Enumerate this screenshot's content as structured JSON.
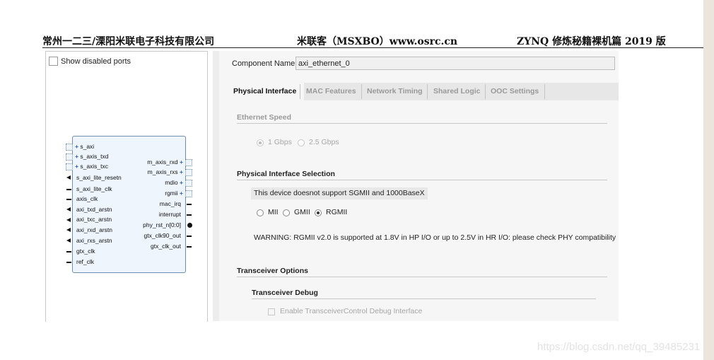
{
  "header": {
    "left": "常州一二三/溧阳米联电子科技有限公司",
    "center": "米联客（MSXBO）www.osrc.cn",
    "right": "ZYNQ 修炼秘籍裸机篇 2019 版"
  },
  "left_panel": {
    "show_disabled_label": "Show disabled ports",
    "show_disabled_checked": false,
    "left_ports": [
      "s_axi",
      "s_axis_txd",
      "s_axis_txc",
      "s_axi_lite_resetn",
      "s_axi_lite_clk",
      "axis_clk",
      "axi_txd_arstn",
      "axi_txc_arstn",
      "axi_rxd_arstn",
      "axi_rxs_arstn",
      "gtx_clk",
      "ref_clk"
    ],
    "right_ports": [
      "m_axis_rxd",
      "m_axis_rxs",
      "mdio",
      "rgmii",
      "mac_irq",
      "interrupt",
      "phy_rst_n[0:0]",
      "gtx_clk90_out",
      "gtx_clk_out"
    ]
  },
  "component": {
    "label": "Component Name",
    "value": "axi_ethernet_0"
  },
  "tabs": [
    "Physical Interface",
    "MAC Features",
    "Network Timing",
    "Shared Logic",
    "OOC Settings"
  ],
  "active_tab": "Physical Interface",
  "ethernet_speed": {
    "title": "Ethernet Speed",
    "options": [
      "1 Gbps",
      "2.5 Gbps"
    ],
    "selected": "1 Gbps"
  },
  "phy_selection": {
    "title": "Physical Interface Selection",
    "message": "This device doesnot support SGMII and 1000BaseX",
    "options": [
      "MII",
      "GMII",
      "RGMII"
    ],
    "selected": "RGMII",
    "warning": "WARNING: RGMII v2.0 is supported at 1.8V in HP I/O or up to 2.5V in HR I/O: please check PHY compatibility"
  },
  "transceiver": {
    "title": "Transceiver Options",
    "debug_title": "Transceiver Debug",
    "debug_checkbox": "Enable TransceiverControl Debug Interface",
    "debug_checked": false
  },
  "watermark": "https://blog.csdn.net/qq_39485231",
  "colors": {
    "block_fill": "#eef5fc",
    "block_border": "#6f8fb0",
    "plus": "#2a60c7",
    "disabled_text": "#a6a6a6"
  }
}
